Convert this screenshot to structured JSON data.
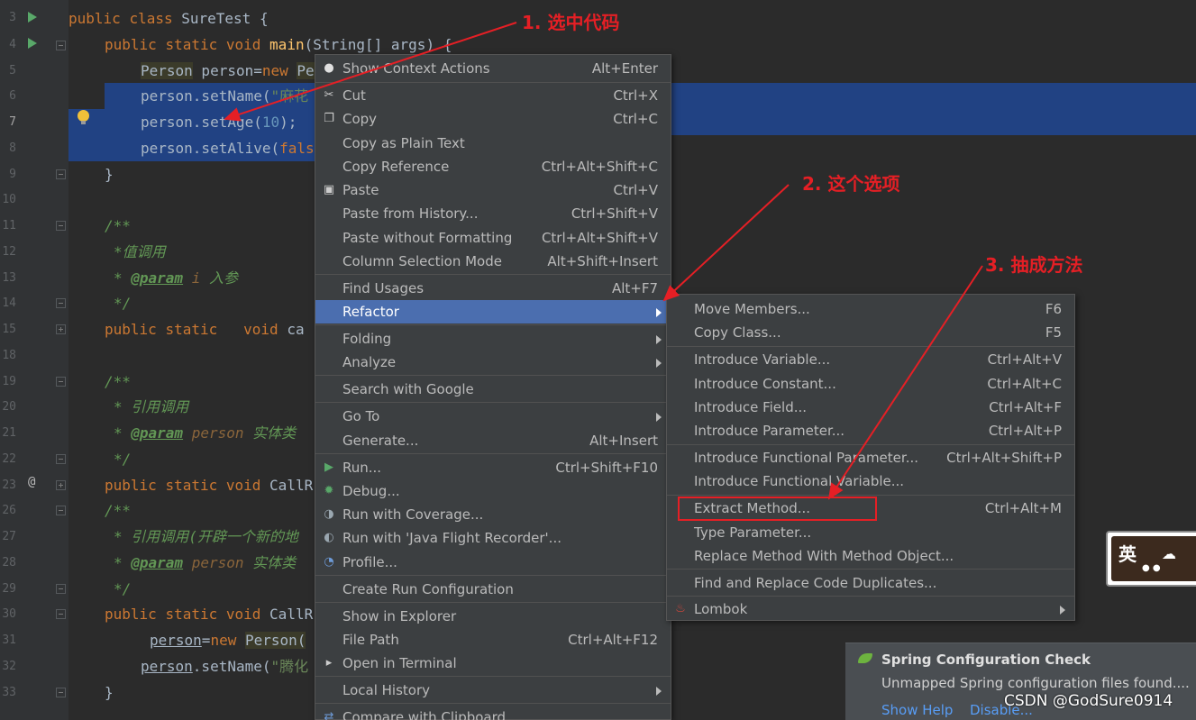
{
  "editor": {
    "line_numbers": [
      "3",
      "4",
      "5",
      "6",
      "7",
      "8",
      "9",
      "10",
      "11",
      "12",
      "13",
      "14",
      "15",
      "18",
      "19",
      "20",
      "21",
      "22",
      "23",
      "26",
      "27",
      "28",
      "29",
      "30",
      "31",
      "32",
      "33"
    ],
    "lines": {
      "l3": [
        "public ",
        "class ",
        "SureTest ",
        "{"
      ],
      "l4": [
        "public ",
        "static ",
        "void ",
        "main",
        "(String[] args) {"
      ],
      "l5": [
        "Person",
        " person=",
        "new ",
        "Pe"
      ],
      "l6": [
        "person.setName(",
        "\"麻花"
      ],
      "l7": [
        "person.setAge(",
        "10",
        ");"
      ],
      "l8": [
        "person.setAlive(",
        "fals"
      ],
      "l9": [
        "}"
      ],
      "l11": [
        "/**"
      ],
      "l12": [
        "*值调用"
      ],
      "l13": [
        "* ",
        "@param",
        " i",
        " 入参"
      ],
      "l14": [
        "*/"
      ],
      "l15": [
        "public ",
        "static ",
        "  void ",
        "ca"
      ],
      "l19": [
        "/**"
      ],
      "l20": [
        "* 引用调用"
      ],
      "l21": [
        "* ",
        "@param",
        " person",
        " 实体类"
      ],
      "l22": [
        "*/"
      ],
      "l23": [
        "public ",
        "static ",
        "void ",
        "CallR"
      ],
      "l26": [
        "/**"
      ],
      "l27": [
        "* 引用调用(开辟一个新的地"
      ],
      "l28": [
        "* ",
        "@param",
        " person",
        " 实体类"
      ],
      "l29": [
        "*/"
      ],
      "l30": [
        "public ",
        "static ",
        "void ",
        "CallR"
      ],
      "l31": [
        "person",
        "=",
        "new ",
        "Person("
      ],
      "l32": [
        "person",
        ".setName(",
        "\"腾化"
      ],
      "l33": [
        "}"
      ]
    }
  },
  "context_menu": {
    "items": [
      {
        "label": "Show Context Actions",
        "shortcut": "Alt+Enter"
      },
      {
        "label": "Cut",
        "shortcut": "Ctrl+X"
      },
      {
        "label": "Copy",
        "shortcut": "Ctrl+C"
      },
      {
        "label": "Copy as Plain Text",
        "shortcut": ""
      },
      {
        "label": "Copy Reference",
        "shortcut": "Ctrl+Alt+Shift+C"
      },
      {
        "label": "Paste",
        "shortcut": "Ctrl+V"
      },
      {
        "label": "Paste from History...",
        "shortcut": "Ctrl+Shift+V"
      },
      {
        "label": "Paste without Formatting",
        "shortcut": "Ctrl+Alt+Shift+V"
      },
      {
        "label": "Column Selection Mode",
        "shortcut": "Alt+Shift+Insert"
      },
      {
        "label": "Find Usages",
        "shortcut": "Alt+F7"
      },
      {
        "label": "Refactor",
        "shortcut": ""
      },
      {
        "label": "Folding",
        "shortcut": ""
      },
      {
        "label": "Analyze",
        "shortcut": ""
      },
      {
        "label": "Search with Google",
        "shortcut": ""
      },
      {
        "label": "Go To",
        "shortcut": ""
      },
      {
        "label": "Generate...",
        "shortcut": "Alt+Insert"
      },
      {
        "label": "Run...",
        "shortcut": "Ctrl+Shift+F10"
      },
      {
        "label": "Debug...",
        "shortcut": ""
      },
      {
        "label": "Run with Coverage...",
        "shortcut": ""
      },
      {
        "label": "Run with 'Java Flight Recorder'...",
        "shortcut": ""
      },
      {
        "label": "Profile...",
        "shortcut": ""
      },
      {
        "label": "Create Run Configuration",
        "shortcut": ""
      },
      {
        "label": "Show in Explorer",
        "shortcut": ""
      },
      {
        "label": "File Path",
        "shortcut": "Ctrl+Alt+F12"
      },
      {
        "label": "Open in Terminal",
        "shortcut": ""
      },
      {
        "label": "Local History",
        "shortcut": ""
      },
      {
        "label": "Compare with Clipboard",
        "shortcut": ""
      }
    ]
  },
  "refactor_submenu": {
    "items": [
      {
        "label": "Move Members...",
        "shortcut": "F6"
      },
      {
        "label": "Copy Class...",
        "shortcut": "F5"
      },
      {
        "label": "Introduce Variable...",
        "shortcut": "Ctrl+Alt+V"
      },
      {
        "label": "Introduce Constant...",
        "shortcut": "Ctrl+Alt+C"
      },
      {
        "label": "Introduce Field...",
        "shortcut": "Ctrl+Alt+F"
      },
      {
        "label": "Introduce Parameter...",
        "shortcut": "Ctrl+Alt+P"
      },
      {
        "label": "Introduce Functional Parameter...",
        "shortcut": "Ctrl+Alt+Shift+P"
      },
      {
        "label": "Introduce Functional Variable...",
        "shortcut": ""
      },
      {
        "label": "Extract Method...",
        "shortcut": "Ctrl+Alt+M"
      },
      {
        "label": "Type Parameter...",
        "shortcut": ""
      },
      {
        "label": "Replace Method With Method Object...",
        "shortcut": ""
      },
      {
        "label": "Find and Replace Code Duplicates...",
        "shortcut": ""
      },
      {
        "label": "Lombok",
        "shortcut": ""
      }
    ]
  },
  "annotations": {
    "a1": "1. 选中代码",
    "a2": "2. 这个选项",
    "a3": "3. 抽成方法"
  },
  "notification": {
    "title": "Spring Configuration Check",
    "body": "Unmapped Spring configuration files found....",
    "show_help": "Show Help",
    "disable": "Disable..."
  },
  "watermark": "CSDN @GodSure0914",
  "ime_label": "英",
  "colors": {
    "annotation_red": "#e51f25",
    "menu_bg": "#3c3f41",
    "menu_active": "#4b6eaf",
    "selection": "#214283"
  }
}
